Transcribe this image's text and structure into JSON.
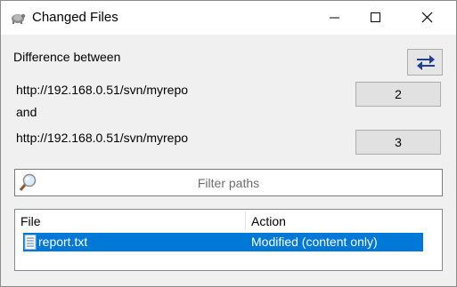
{
  "window": {
    "title": "Changed Files"
  },
  "titlebar": {
    "minimize": "minimize",
    "maximize": "maximize",
    "close": "close"
  },
  "diff": {
    "heading": "Difference between",
    "url_from": "http://192.168.0.51/svn/myrepo",
    "conjunction": "and",
    "url_to": "http://192.168.0.51/svn/myrepo",
    "rev_from": "2",
    "rev_to": "3"
  },
  "filter": {
    "placeholder": "Filter paths"
  },
  "list": {
    "columns": [
      "File",
      "Action"
    ],
    "rows": [
      {
        "file": "report.txt",
        "action": "Modified (content only)",
        "selected": true
      }
    ]
  },
  "colors": {
    "selection": "#0078d7",
    "swap_arrows": "#1f3f8f"
  },
  "icons": [
    "app-turtle-icon",
    "swap-arrows-icon",
    "magnifier-icon",
    "text-file-icon"
  ]
}
